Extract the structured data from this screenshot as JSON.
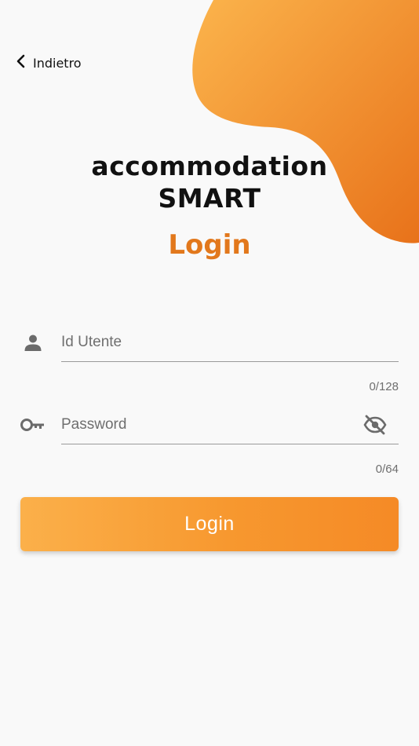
{
  "header": {
    "back_label": "Indietro",
    "back_icon": "chevron-left-icon"
  },
  "branding": {
    "title_line1": "accommodation",
    "title_line2": "SMART",
    "subtitle": "Login"
  },
  "form": {
    "user": {
      "icon": "person-icon",
      "placeholder": "Id Utente",
      "value": "",
      "counter": "0/128"
    },
    "password": {
      "icon": "key-icon",
      "placeholder": "Password",
      "value": "",
      "counter": "0/64",
      "visibility_icon": "eye-off-icon"
    },
    "submit_label": "Login"
  },
  "colors": {
    "accent": "#e2781c",
    "blob_start": "#fbb04a",
    "blob_end": "#e8721a",
    "button_start": "#fbb04a",
    "button_end": "#f58a26",
    "background": "#f9f9f9"
  }
}
